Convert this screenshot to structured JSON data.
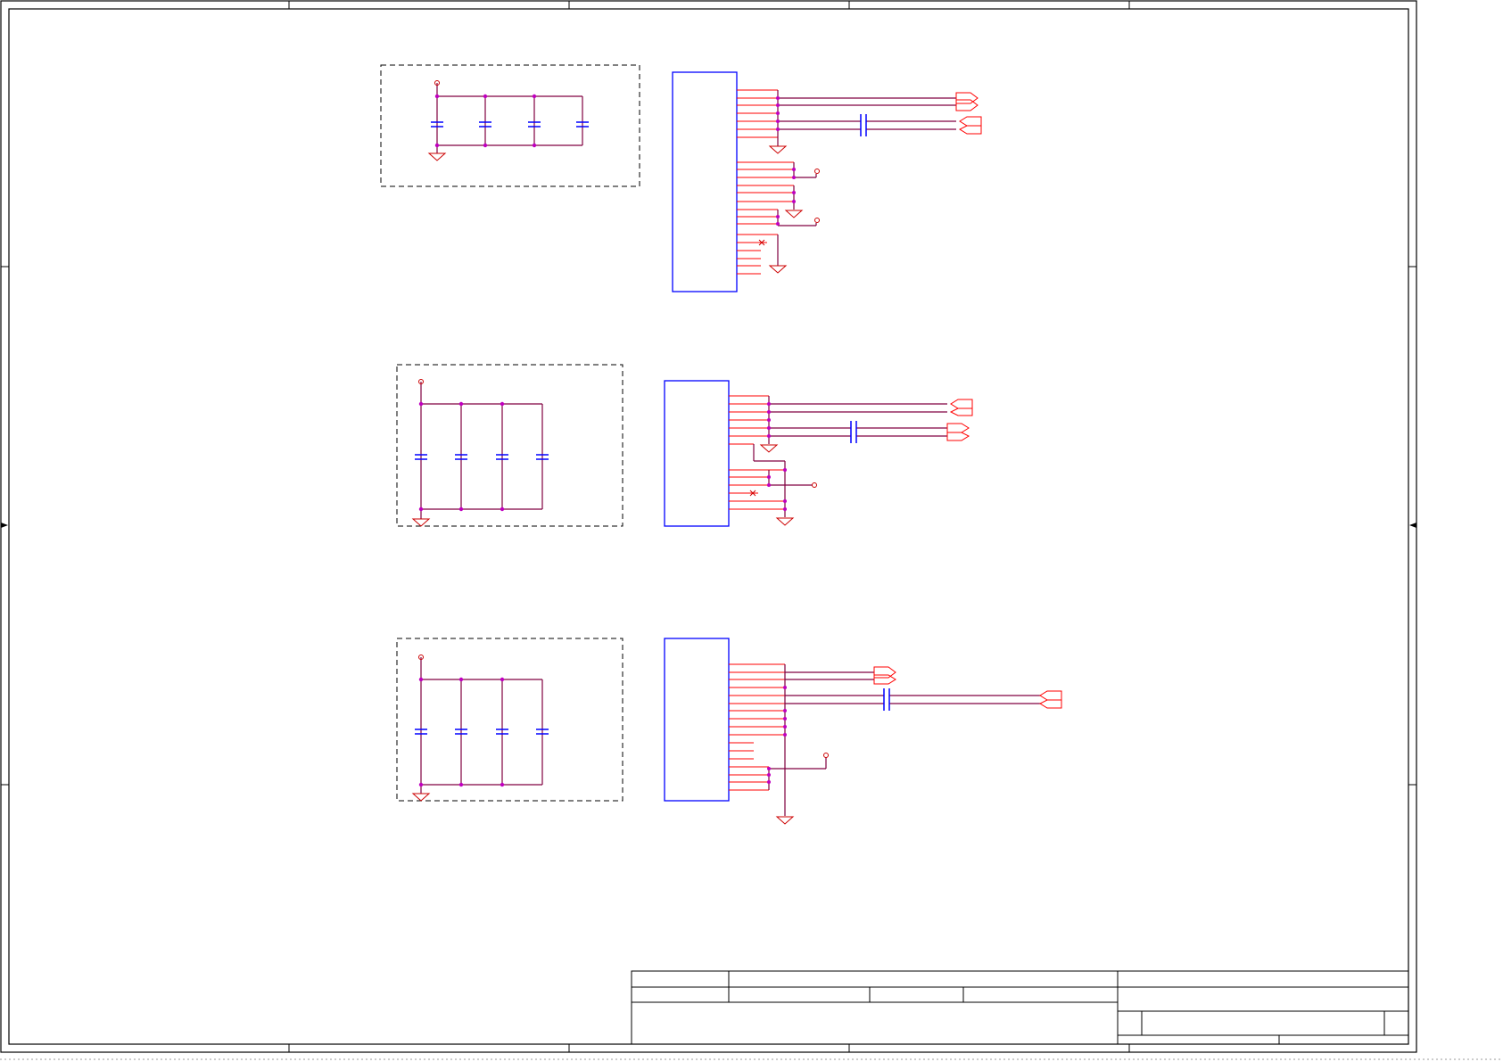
{
  "sheet": {
    "paper_color": "#ffffff",
    "frame_color": "#000000",
    "wire_color": "#800040",
    "junction_color": "#c000c0",
    "power_symbol_color": "#cc0000",
    "component_color": "#0000ff",
    "port_color": "#ff0000",
    "group_outline_color": "#000000"
  },
  "blocks": [
    {
      "name": "decoupling-group-1",
      "capacitor_count": 4
    },
    {
      "name": "connector-1",
      "pin_stubs": 24
    },
    {
      "name": "decoupling-group-2",
      "capacitor_count": 4
    },
    {
      "name": "connector-2",
      "pin_stubs": 16
    },
    {
      "name": "decoupling-group-3",
      "capacitor_count": 4
    },
    {
      "name": "connector-3",
      "pin_stubs": 17
    }
  ],
  "icons": {
    "ground": "ground-symbol-icon",
    "power": "power-port-icon",
    "no_connect": "no-connect-icon",
    "port": "off-page-port-icon"
  }
}
